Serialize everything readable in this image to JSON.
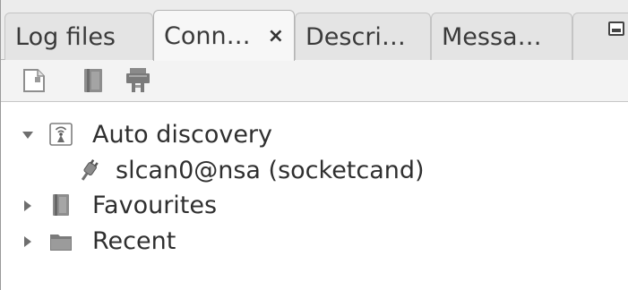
{
  "tabs": [
    {
      "label": "Log files",
      "active": false
    },
    {
      "label": "Conn…",
      "active": true,
      "close": "×"
    },
    {
      "label": "Descri…",
      "active": false
    },
    {
      "label": "Messa…",
      "active": false
    }
  ],
  "window_button_icon": "minimize-icon",
  "toolbar": {
    "icons": [
      "new-connection-icon",
      "favourite-bookmark-icon",
      "connect-device-icon"
    ]
  },
  "tree": {
    "auto_discovery": {
      "label": "Auto discovery",
      "expanded": true,
      "icon": "broadcast-icon",
      "children": [
        {
          "label": "slcan0@nsa (socketcand)",
          "icon": "plug-icon"
        }
      ]
    },
    "favourites": {
      "label": "Favourites",
      "expanded": false,
      "icon": "bookmark-icon"
    },
    "recent": {
      "label": "Recent",
      "expanded": false,
      "icon": "folder-icon"
    }
  },
  "colors": {
    "tab_bg": "#e4e4e4",
    "active_tab_bg": "#f7f7f7",
    "toolbar_bg": "#f3f3f3",
    "text": "#2f2f2f"
  }
}
